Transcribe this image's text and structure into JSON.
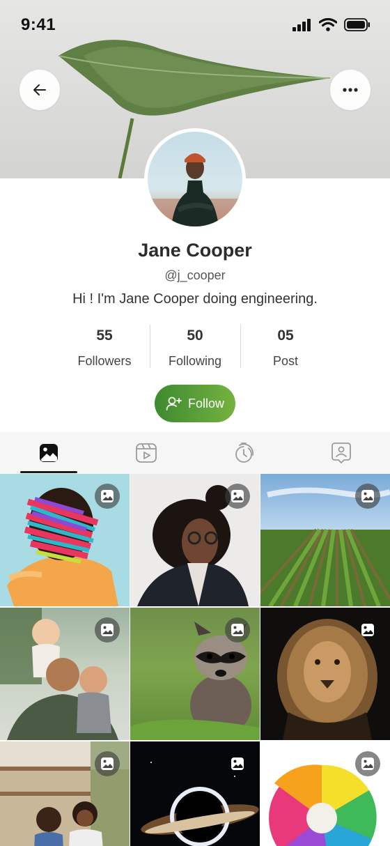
{
  "status": {
    "time": "9:41"
  },
  "profile": {
    "name": "Jane Cooper",
    "handle": "@j_cooper",
    "bio": "Hi ! I'm Jane Cooper doing engineering."
  },
  "stats": [
    {
      "value": "55",
      "label": "Followers"
    },
    {
      "value": "50",
      "label": "Following"
    },
    {
      "value": "05",
      "label": "Post"
    }
  ],
  "follow_label": "Follow",
  "tabs": [
    {
      "icon": "photos-icon",
      "active": true
    },
    {
      "icon": "video-icon",
      "active": false
    },
    {
      "icon": "timer-icon",
      "active": false
    },
    {
      "icon": "user-badge-icon",
      "active": false
    }
  ],
  "grid": [
    {
      "subject": "colorful-portrait"
    },
    {
      "subject": "woman-glasses"
    },
    {
      "subject": "field"
    },
    {
      "subject": "family"
    },
    {
      "subject": "raccoon"
    },
    {
      "subject": "lion"
    },
    {
      "subject": "kids-kitchen"
    },
    {
      "subject": "black-hole"
    },
    {
      "subject": "flower"
    }
  ],
  "colors": {
    "accent": "#5ea23a",
    "tab_bg": "#f6f6f6"
  }
}
